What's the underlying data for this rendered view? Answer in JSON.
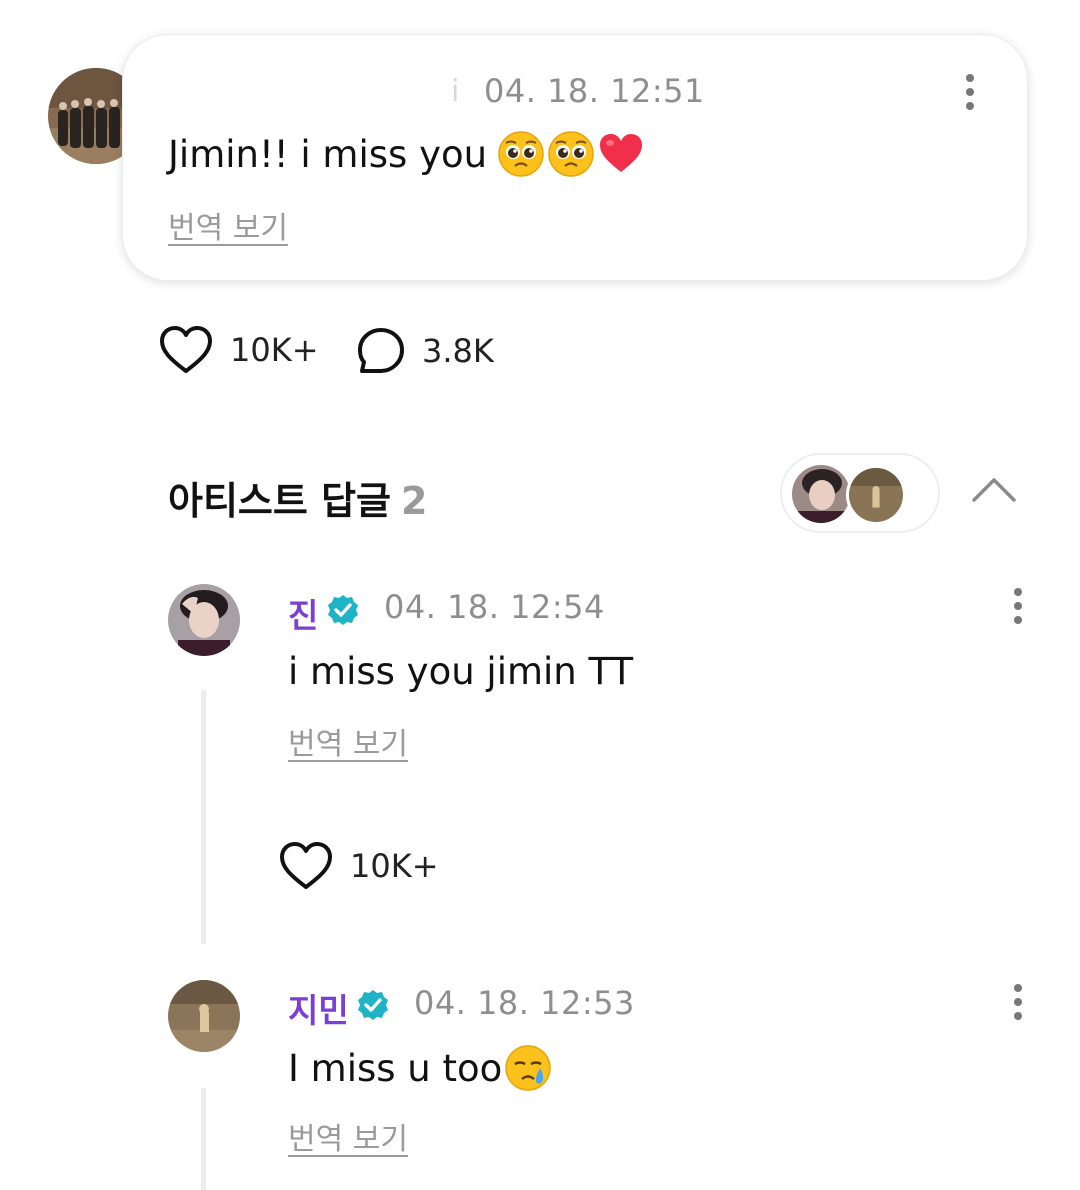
{
  "post": {
    "timestamp": "04. 18. 12:51",
    "faint_prefix": "i",
    "text": "Jimin!! i miss you",
    "emojis": [
      "pleading-face-emoji",
      "pleading-face-emoji",
      "red-heart-emoji"
    ],
    "translate_label": "번역 보기"
  },
  "stats": {
    "likes": "10K+",
    "comments": "3.8K"
  },
  "artist_replies": {
    "title": "아티스트 답글",
    "count": "2"
  },
  "replies": [
    {
      "name": "진",
      "timestamp": "04. 18. 12:54",
      "text": "i miss you jimin TT",
      "translate_label": "번역 보기",
      "likes": "10K+"
    },
    {
      "name": "지민",
      "timestamp": "04. 18. 12:53",
      "text": "I miss u too",
      "emojis": [
        "crying-face-emoji"
      ],
      "translate_label": "번역 보기"
    }
  ],
  "colors": {
    "artist_name": "#7b3fd6",
    "verified_badge": "#1fb3c6",
    "muted_text": "#8e8e8e"
  }
}
